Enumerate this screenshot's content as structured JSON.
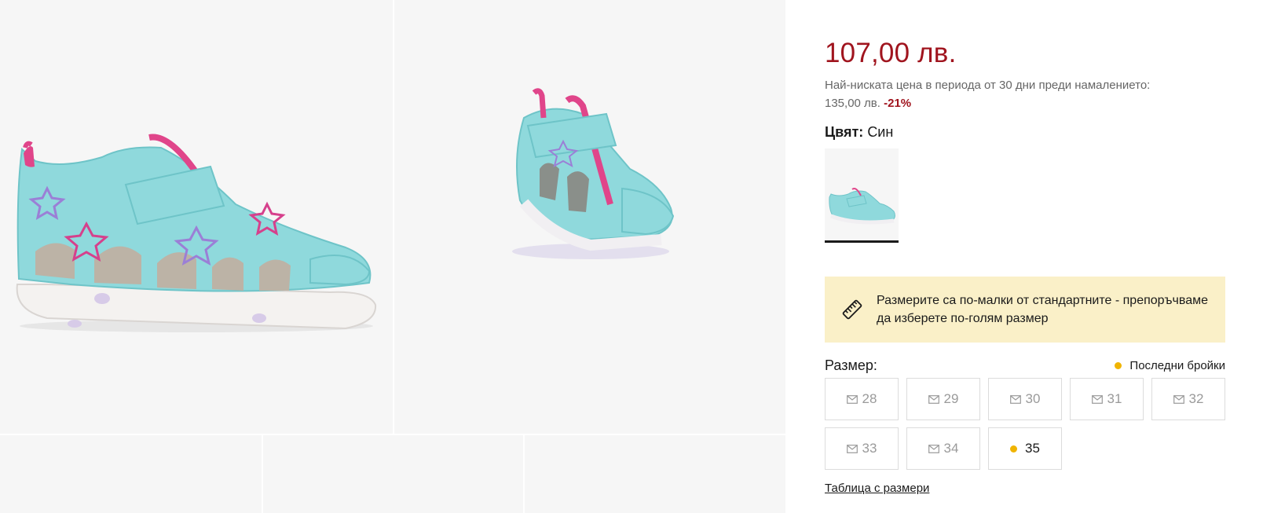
{
  "product": {
    "price": "107,00 лв.",
    "lowest_price_text": "Най-ниската цена в периода от 30 дни преди намалението:",
    "lowest_price_value": "135,00 лв.",
    "discount": "-21%",
    "color_label": "Цвят:",
    "color_value": "Син"
  },
  "notice": {
    "text": "Размерите са по-малки от стандартните - препоръчваме да изберете по-голям размер",
    "icon": "ruler-icon"
  },
  "sizes": {
    "label": "Размер:",
    "last_items_label": "Последни бройки",
    "items": [
      {
        "value": "28",
        "available": false
      },
      {
        "value": "29",
        "available": false
      },
      {
        "value": "30",
        "available": false
      },
      {
        "value": "31",
        "available": false
      },
      {
        "value": "32",
        "available": false
      },
      {
        "value": "33",
        "available": false
      },
      {
        "value": "34",
        "available": false
      },
      {
        "value": "35",
        "available": true
      }
    ],
    "table_link": "Таблица с размери"
  },
  "colors": {
    "price": "#a0141e",
    "notice_bg": "#faf0c8",
    "last_items_dot": "#f0b400"
  }
}
